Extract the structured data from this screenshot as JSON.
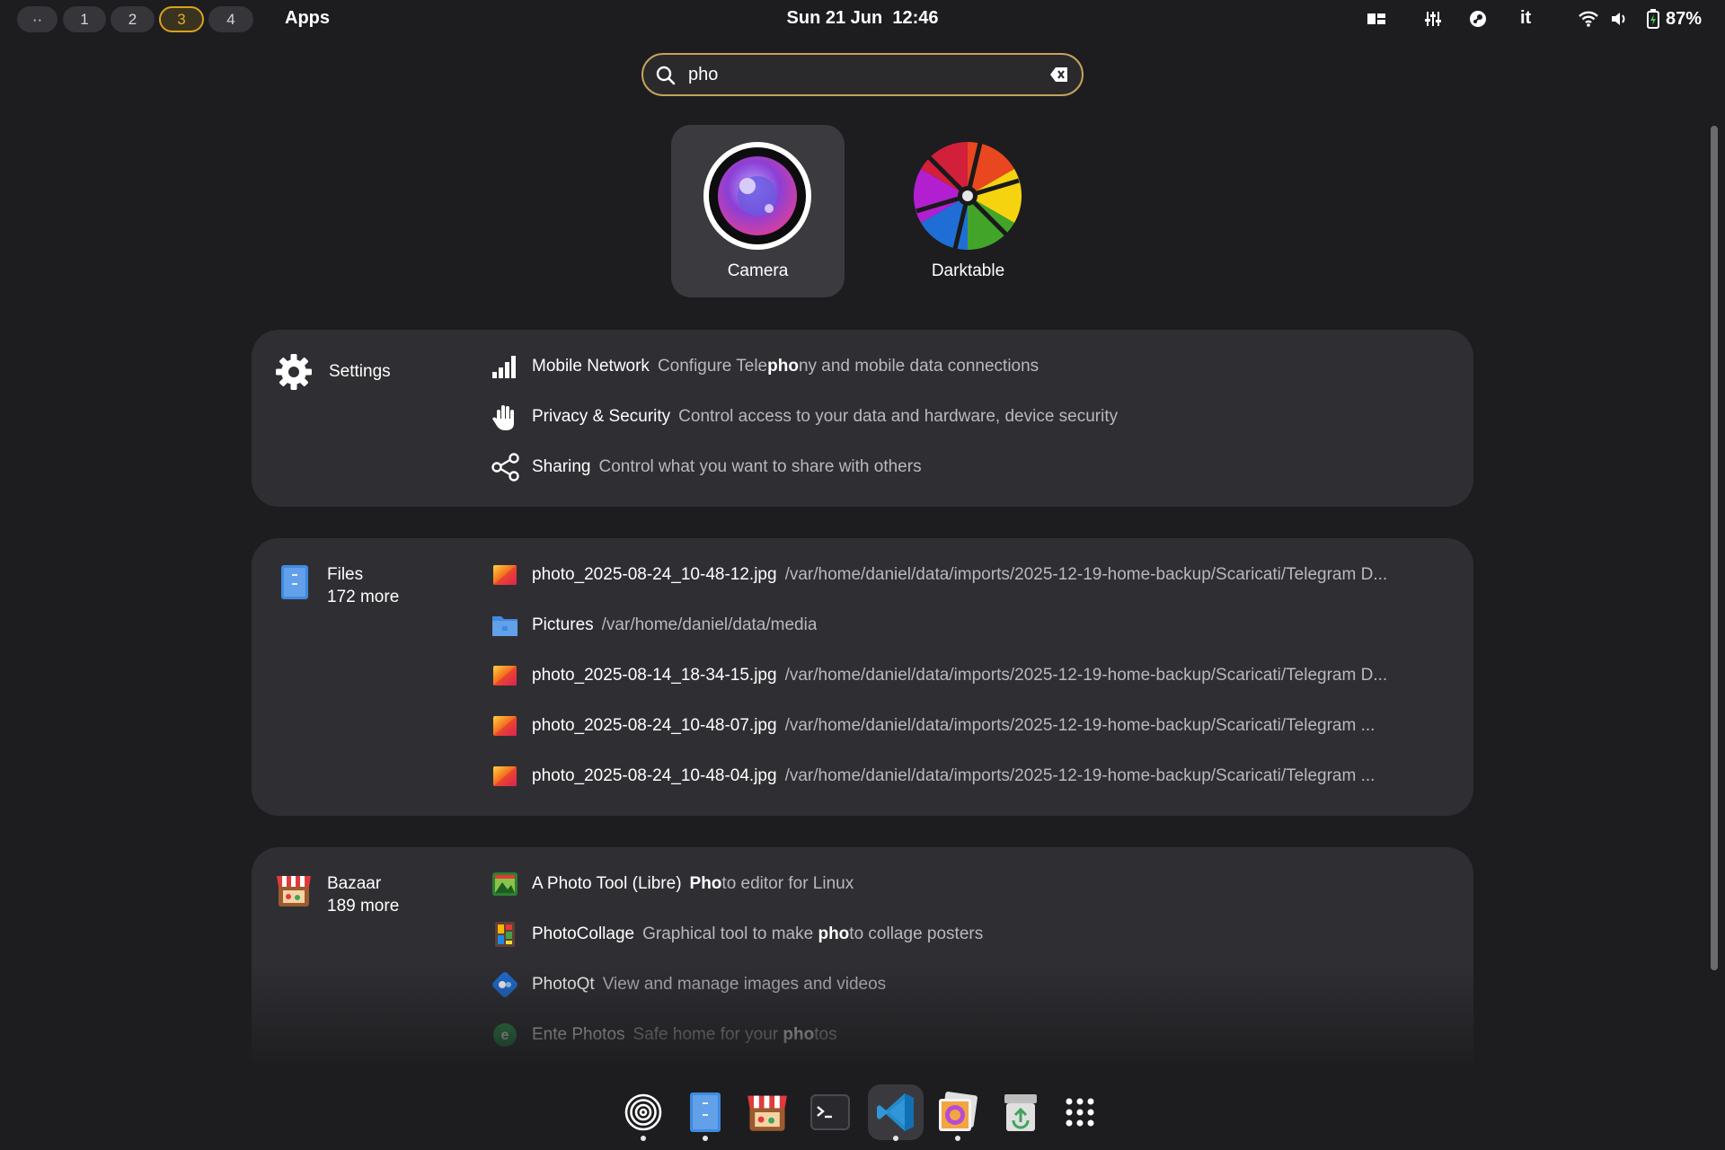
{
  "topbar": {
    "workspaces": [
      "··",
      "1",
      "2",
      "3",
      "4"
    ],
    "active_workspace": "3",
    "apps_label": "Apps",
    "clock": "Sun 21 Jun  12:46",
    "keyboard_layout": "it",
    "battery_percent": "87%"
  },
  "search": {
    "query": "pho"
  },
  "apps": [
    {
      "name": "Camera",
      "icon": "camera-icon"
    },
    {
      "name": "Darktable",
      "icon": "darktable-icon"
    }
  ],
  "settings": {
    "provider": "Settings",
    "rows": [
      {
        "title": "Mobile Network",
        "desc_pre": "Configure Tele",
        "desc_bold": "pho",
        "desc_post": "ny and mobile data connections",
        "icon": "signal-bars-icon"
      },
      {
        "title": "Privacy & Security",
        "desc_pre": "Control access to your data and hardware, device security",
        "desc_bold": "",
        "desc_post": "",
        "icon": "hand-icon"
      },
      {
        "title": "Sharing",
        "desc_pre": "Control what you want to share with others",
        "desc_bold": "",
        "desc_post": "",
        "icon": "share-icon"
      }
    ]
  },
  "files": {
    "provider": "Files",
    "more": "172 more",
    "rows": [
      {
        "title": "photo_2025-08-24_10-48-12.jpg",
        "path": "/var/home/daniel/data/imports/2025-12-19-home-backup/Scaricati/Telegram D...",
        "icon": "image-file-icon"
      },
      {
        "title": "Pictures",
        "path": "/var/home/daniel/data/media",
        "icon": "folder-icon"
      },
      {
        "title": "photo_2025-08-14_18-34-15.jpg",
        "path": "/var/home/daniel/data/imports/2025-12-19-home-backup/Scaricati/Telegram D...",
        "icon": "image-file-icon"
      },
      {
        "title": "photo_2025-08-24_10-48-07.jpg",
        "path": "/var/home/daniel/data/imports/2025-12-19-home-backup/Scaricati/Telegram ...",
        "icon": "image-file-icon"
      },
      {
        "title": "photo_2025-08-24_10-48-04.jpg",
        "path": "/var/home/daniel/data/imports/2025-12-19-home-backup/Scaricati/Telegram ...",
        "icon": "image-file-icon"
      }
    ]
  },
  "bazaar": {
    "provider": "Bazaar",
    "more": "189 more",
    "rows": [
      {
        "title": "A Photo Tool (Libre)",
        "desc_pre": "",
        "desc_bold": "Pho",
        "desc_post": "to editor for Linux",
        "icon": "aphototool-icon"
      },
      {
        "title": "PhotoCollage",
        "desc_pre": "Graphical tool to make ",
        "desc_bold": "pho",
        "desc_post": "to collage posters",
        "icon": "photocollage-icon"
      },
      {
        "title": "PhotoQt",
        "desc_pre": "View and manage images and videos",
        "desc_bold": "",
        "desc_post": "",
        "icon": "photoqt-icon"
      },
      {
        "title": "Ente Photos",
        "desc_pre": "Safe home for your ",
        "desc_bold": "pho",
        "desc_post": "tos",
        "icon": "ente-icon"
      }
    ]
  },
  "dock": [
    {
      "name": "fingerprint-app",
      "icon": "fingerprint-icon",
      "running": true
    },
    {
      "name": "files",
      "icon": "files-icon",
      "running": true
    },
    {
      "name": "bazaar",
      "icon": "bazaar-icon",
      "running": false
    },
    {
      "name": "terminal",
      "icon": "terminal-icon",
      "running": false
    },
    {
      "name": "vscode",
      "icon": "vscode-icon",
      "running": true
    },
    {
      "name": "image-viewer",
      "icon": "image-viewer-icon",
      "running": true
    },
    {
      "name": "trash",
      "icon": "trash-icon",
      "running": false
    },
    {
      "name": "app-grid",
      "icon": "app-grid-icon",
      "running": false
    }
  ]
}
